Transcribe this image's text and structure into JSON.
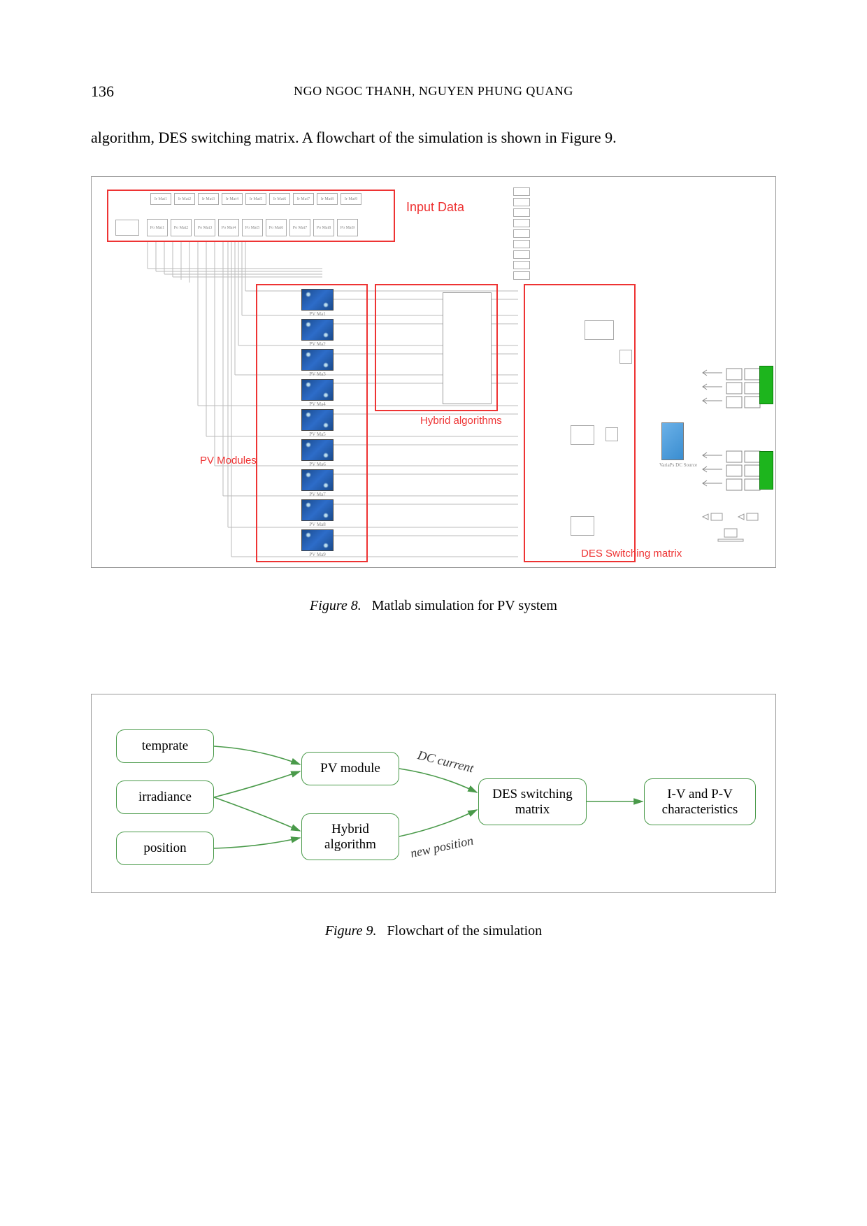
{
  "page_number": "136",
  "authors_header": "NGO NGOC THANH, NGUYEN PHUNG QUANG",
  "body_text": "algorithm, DES switching matrix. A flowchart of the simulation is shown in Figure 9.",
  "figure8": {
    "caption_label": "Figure 8.",
    "caption_text": "Matlab simulation for PV system",
    "labels": {
      "input": "Input Data",
      "pv": "PV Modules",
      "hybrid": "Hybrid algorithms",
      "des": "DES Switching matrix"
    },
    "input_top": [
      "Ir Mat1",
      "Ir Mat2",
      "Ir Mat3",
      "Ir Mat4",
      "Ir Mat5",
      "Ir Mat6",
      "Ir Mat7",
      "Ir Mat8",
      "Ir Mat9"
    ],
    "input_bot": [
      "Po Mat1",
      "Po Mat2",
      "Po Mat3",
      "Po Mat4",
      "Po Mat5",
      "Po Mat6",
      "Po Mat7",
      "Po Mat8",
      "Po Mat9"
    ],
    "pv_sublabels": [
      "PV Ma1",
      "PV Ma2",
      "PV Ma3",
      "PV Ma4",
      "PV Ma5",
      "PV Ma6",
      "PV Ma7",
      "PV Ma8",
      "PV Ma9"
    ],
    "dc_source": "VariaPs DC Source"
  },
  "figure9": {
    "caption_label": "Figure 9.",
    "caption_text": "Flowchart of the simulation",
    "boxes": {
      "temprate": "temprate",
      "irradiance": "irradiance",
      "position": "position",
      "pv_module": "PV module",
      "hybrid": "Hybrid algorithm",
      "des": "DES switching matrix",
      "iv_pv": "I-V and P-V characteristics"
    },
    "edges": {
      "dc_current": "DC current",
      "new_position": "new position"
    }
  }
}
